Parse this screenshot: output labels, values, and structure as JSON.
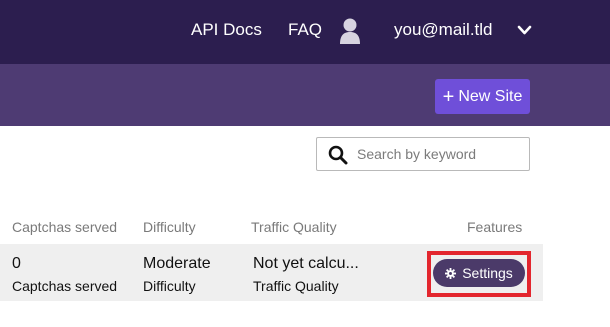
{
  "header": {
    "nav": [
      {
        "label": "API Docs"
      },
      {
        "label": "FAQ"
      }
    ],
    "user": {
      "email": "you@mail.tld",
      "avatar_icon": "user-silhouette-icon",
      "menu_icon": "chevron-down-icon"
    }
  },
  "toolbar": {
    "new_site_label": "New Site",
    "new_site_icon": "plus-icon"
  },
  "search": {
    "placeholder": "Search by keyword",
    "value": "",
    "icon": "search-icon"
  },
  "table": {
    "columns": [
      "Captchas served",
      "Difficulty",
      "Traffic Quality",
      "Features"
    ],
    "rows": [
      {
        "captchas_served": {
          "value": "0",
          "label": "Captchas served"
        },
        "difficulty": {
          "value": "Moderate",
          "label": "Difficulty"
        },
        "traffic_quality": {
          "value": "Not yet calcu...",
          "label": "Traffic Quality"
        },
        "settings_label": "Settings",
        "settings_icon": "gear-icon"
      }
    ]
  },
  "colors": {
    "topbar": "#2c1e4f",
    "subbar": "#4e3b73",
    "accent": "#6f4fd9",
    "settings_button": "#4b3a69",
    "highlight": "#e3262e",
    "row_background": "#efefef"
  }
}
